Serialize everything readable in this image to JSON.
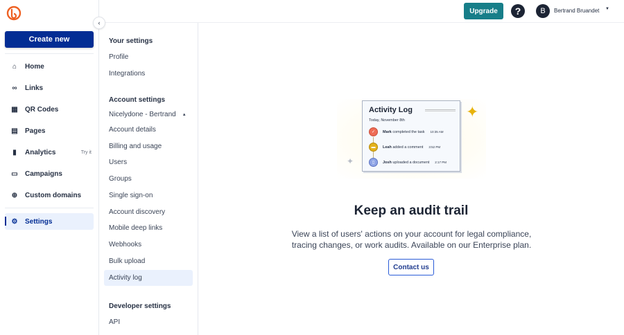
{
  "sidebar": {
    "create_label": "Create new",
    "items": [
      {
        "label": "Home",
        "icon": "home-icon",
        "glyph": "⌂"
      },
      {
        "label": "Links",
        "icon": "link-icon",
        "glyph": "🔗"
      },
      {
        "label": "QR Codes",
        "icon": "qr-code-icon",
        "glyph": "▦"
      },
      {
        "label": "Pages",
        "icon": "pages-icon",
        "glyph": "▤"
      },
      {
        "label": "Analytics",
        "icon": "analytics-icon",
        "glyph": "▮",
        "badge": "Try it"
      },
      {
        "label": "Campaigns",
        "icon": "campaigns-icon",
        "glyph": "▭"
      },
      {
        "label": "Custom domains",
        "icon": "globe-icon",
        "glyph": "⊕"
      }
    ],
    "settings_label": "Settings",
    "settings_glyph": "⚙"
  },
  "topbar": {
    "upgrade_label": "Upgrade",
    "help_glyph": "?",
    "avatar_initial": "B",
    "user_name": "Bertrand Bruandet"
  },
  "settings_nav": {
    "your_settings": {
      "title": "Your settings",
      "items": [
        "Profile",
        "Integrations"
      ]
    },
    "account_settings": {
      "title": "Account settings",
      "account": "Nicelydone - Bertrand",
      "items": [
        "Account details",
        "Billing and usage",
        "Users",
        "Groups",
        "Single sign-on",
        "Account discovery",
        "Mobile deep links",
        "Webhooks",
        "Bulk upload",
        "Activity log"
      ]
    },
    "developer_settings": {
      "title": "Developer settings",
      "items": [
        "API"
      ]
    }
  },
  "main": {
    "illustration": {
      "title": "Activity Log",
      "date": "Today, November 8th",
      "entries": [
        {
          "name": "Mark",
          "action": "completed the task",
          "time": "10:35 AM",
          "color": "#ee6c55"
        },
        {
          "name": "Leah",
          "action": "added a comment",
          "time": "3:52 PM",
          "color": "#e3b21c"
        },
        {
          "name": "Josh",
          "action": "uploaded a document",
          "time": "2:17 PM",
          "color": "#8ea4e6"
        }
      ]
    },
    "heading": "Keep an audit trail",
    "description": "View a list of users' actions on your account for legal compliance, tracing changes, or work audits. Available on our Enterprise plan.",
    "contact_label": "Contact us"
  }
}
